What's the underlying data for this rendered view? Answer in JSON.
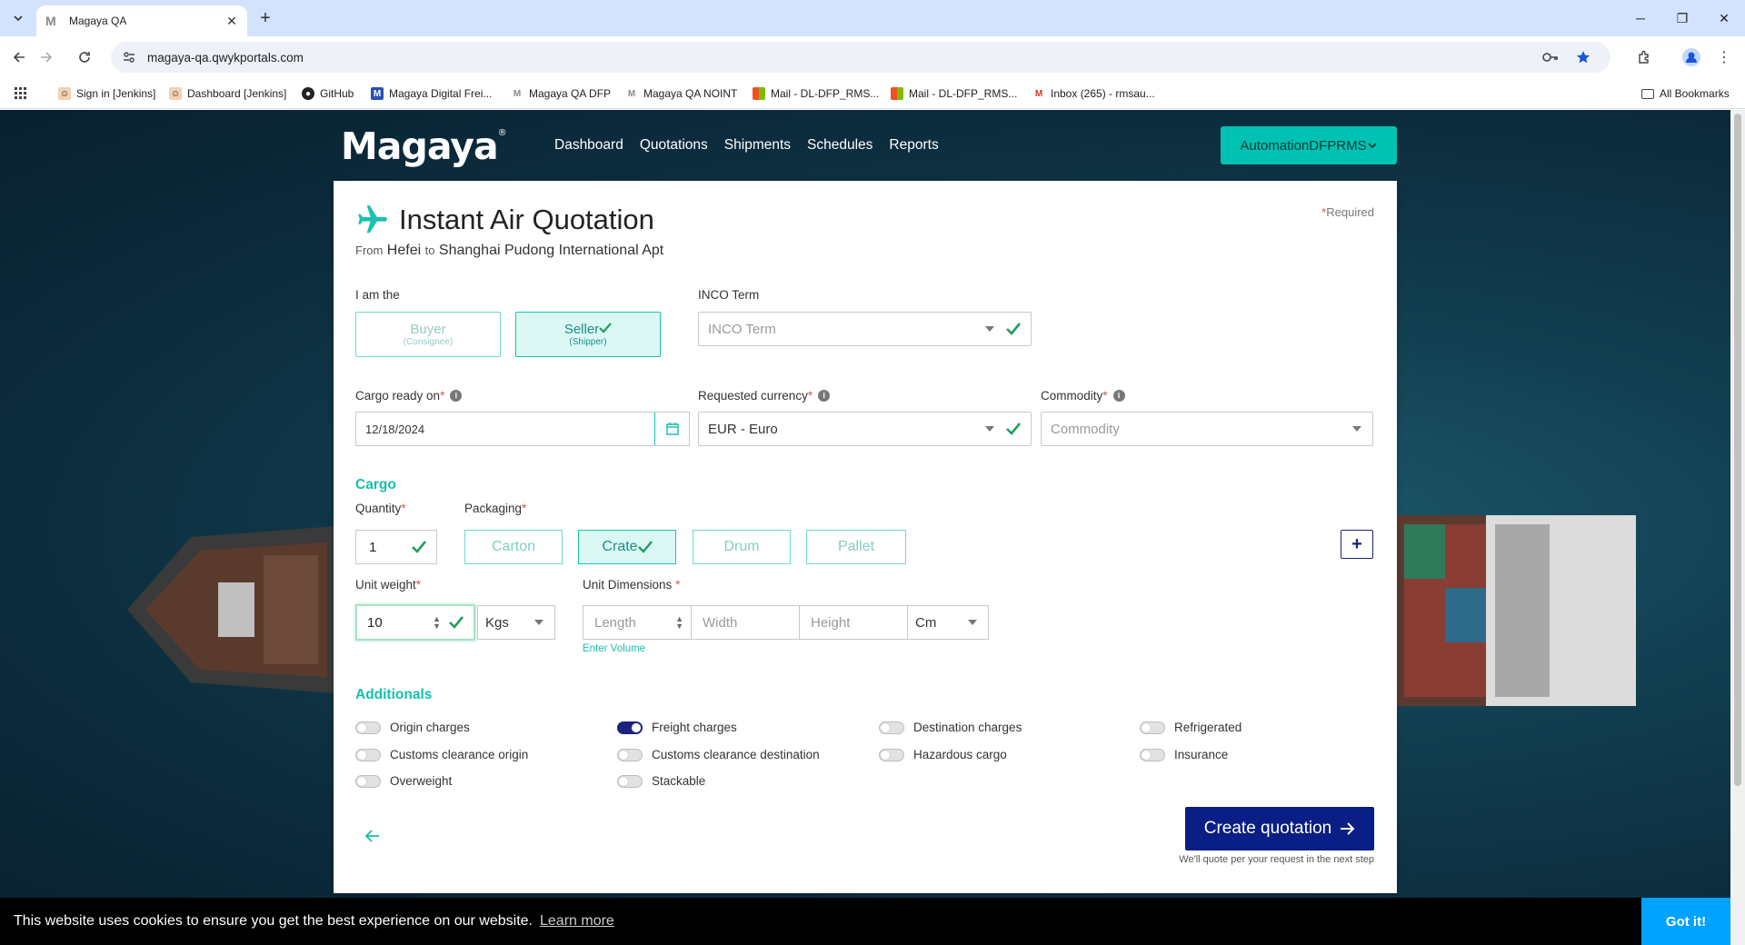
{
  "browser": {
    "tab_title": "Magaya QA",
    "url": "magaya-qa.qwykportals.com",
    "bookmarks": [
      "Sign in [Jenkins]",
      "Dashboard [Jenkins]",
      "GitHub",
      "Magaya Digital Frei...",
      "Magaya QA DFP",
      "Magaya QA NOINT",
      "Mail - DL-DFP_RMS...",
      "Mail - DL-DFP_RMS...",
      "Inbox (265) - rmsau..."
    ],
    "all_bookmarks": "All Bookmarks"
  },
  "header": {
    "brand": "Magaya",
    "nav": [
      "Dashboard",
      "Quotations",
      "Shipments",
      "Schedules",
      "Reports"
    ],
    "account": "AutomationDFPRMS"
  },
  "quote": {
    "title": "Instant Air Quotation",
    "from_label": "From",
    "origin": "Hefei",
    "to_label": "to",
    "destination": "Shanghai Pudong International Apt",
    "required_note": "Required",
    "role_label": "I am the",
    "roles": [
      {
        "main": "Buyer",
        "sub": "(Consignee)",
        "selected": false
      },
      {
        "main": "Seller",
        "sub": "(Shipper)",
        "selected": true
      }
    ],
    "inco_label": "INCO Term",
    "inco_placeholder": "INCO Term",
    "cargo_ready_label": "Cargo ready on",
    "cargo_ready_value": "12/18/2024",
    "currency_label": "Requested currency",
    "currency_value": "EUR - Euro",
    "commodity_label": "Commodity",
    "commodity_placeholder": "Commodity"
  },
  "cargo": {
    "section_title": "Cargo",
    "quantity_label": "Quantity",
    "quantity_value": "1",
    "packaging_label": "Packaging",
    "packaging_options": [
      {
        "label": "Carton",
        "selected": false
      },
      {
        "label": "Crate",
        "selected": true
      },
      {
        "label": "Drum",
        "selected": false
      },
      {
        "label": "Pallet",
        "selected": false
      }
    ],
    "weight_label": "Unit weight",
    "weight_value": "10",
    "weight_unit": "Kgs",
    "dims_label": "Unit Dimensions",
    "length_placeholder": "Length",
    "width_placeholder": "Width",
    "height_placeholder": "Height",
    "dim_unit": "Cm",
    "enter_volume": "Enter Volume"
  },
  "additionals": {
    "section_title": "Additionals",
    "items": [
      {
        "label": "Origin charges",
        "on": false
      },
      {
        "label": "Freight charges",
        "on": true
      },
      {
        "label": "Destination charges",
        "on": false
      },
      {
        "label": "Refrigerated",
        "on": false
      },
      {
        "label": "Customs clearance origin",
        "on": false
      },
      {
        "label": "Customs clearance destination",
        "on": false
      },
      {
        "label": "Hazardous cargo",
        "on": false
      },
      {
        "label": "Insurance",
        "on": false
      },
      {
        "label": "Overweight",
        "on": false
      },
      {
        "label": "Stackable",
        "on": false
      }
    ]
  },
  "actions": {
    "create_label": "Create quotation",
    "note": "We'll quote per your request in the next step"
  },
  "cookie": {
    "message": "This website uses cookies to ensure you get the best experience on our website.",
    "learn_more": "Learn more",
    "accept": "Got it!"
  },
  "colors": {
    "teal": "#16bfae",
    "navy": "#0a1f85",
    "check_green": "#1e9e5a"
  }
}
